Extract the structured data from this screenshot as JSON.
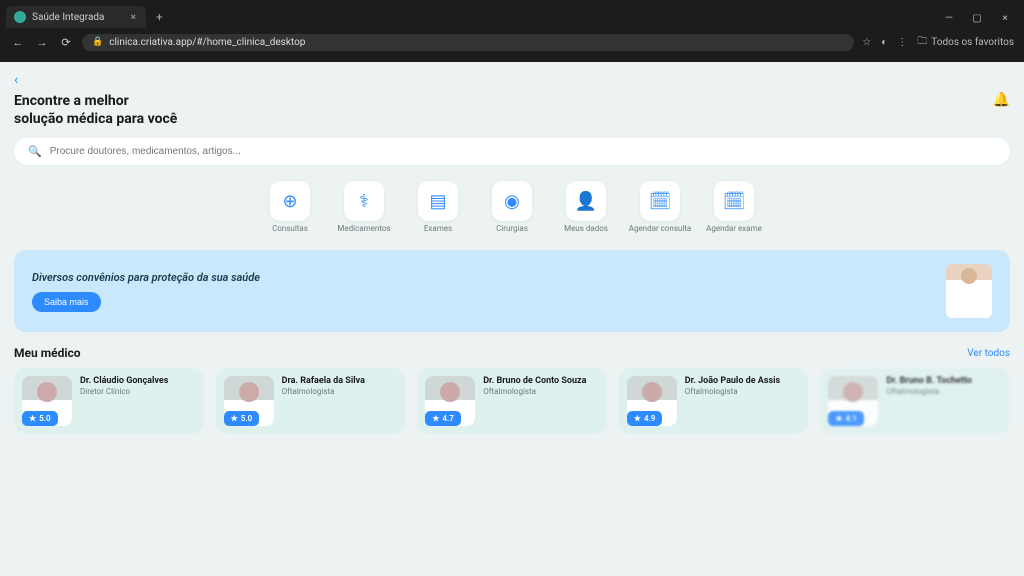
{
  "browser": {
    "tab_title": "Saúde Integrada",
    "url": "clinica.criativa.app/#/home_clinica_desktop",
    "favorites_label": "Todos os favoritos"
  },
  "page": {
    "headline_line1": "Encontre a melhor",
    "headline_line2": "solução médica para você",
    "search_placeholder": "Procure doutores, medicamentos, artigos...",
    "categories": [
      {
        "label": "Consultas",
        "icon": "⊕"
      },
      {
        "label": "Medicamentos",
        "icon": "⚕"
      },
      {
        "label": "Exames",
        "icon": "▤"
      },
      {
        "label": "Cirurgias",
        "icon": "◉"
      },
      {
        "label": "Meus dados",
        "icon": "👤"
      },
      {
        "label": "Agendar consulta",
        "icon": "🗓"
      },
      {
        "label": "Agendar exame",
        "icon": "🗓"
      }
    ],
    "banner_text": "Diversos convênios para proteção da sua saúde",
    "banner_cta": "Saiba mais",
    "section_title": "Meu médico",
    "view_all": "Ver todos",
    "doctors": [
      {
        "name": "Dr. Cláudio Gonçalves",
        "role": "Diretor Clínico",
        "rating": "5.0"
      },
      {
        "name": "Dra. Rafaela da Silva",
        "role": "Oftalmologista",
        "rating": "5.0"
      },
      {
        "name": "Dr. Bruno de Conto Souza",
        "role": "Oftalmologista",
        "rating": "4.7"
      },
      {
        "name": "Dr. João Paulo de Assis",
        "role": "Oftalmologista",
        "rating": "4.9"
      },
      {
        "name": "Dr. Bruno B. Tochetto",
        "role": "Oftalmologista",
        "rating": "4.1"
      }
    ]
  }
}
